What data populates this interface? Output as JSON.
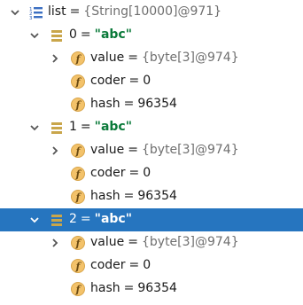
{
  "root": {
    "name": "list",
    "eq": "=",
    "value": "{String[10000]@971}",
    "expanded": true
  },
  "items": [
    {
      "name": "0",
      "eq": "=",
      "value": "\"abc\"",
      "expanded": true,
      "fields": [
        {
          "name": "value",
          "eq": "=",
          "value": "{byte[3]@974}",
          "kind": "ref",
          "expandable": true
        },
        {
          "name": "coder",
          "eq": "=",
          "value": "0",
          "kind": "num",
          "expandable": false
        },
        {
          "name": "hash",
          "eq": "=",
          "value": "96354",
          "kind": "num",
          "expandable": false
        }
      ]
    },
    {
      "name": "1",
      "eq": "=",
      "value": "\"abc\"",
      "expanded": true,
      "fields": [
        {
          "name": "value",
          "eq": "=",
          "value": "{byte[3]@974}",
          "kind": "ref",
          "expandable": true
        },
        {
          "name": "coder",
          "eq": "=",
          "value": "0",
          "kind": "num",
          "expandable": false
        },
        {
          "name": "hash",
          "eq": "=",
          "value": "96354",
          "kind": "num",
          "expandable": false
        }
      ]
    },
    {
      "name": "2",
      "eq": "=",
      "value": "\"abc\"",
      "expanded": true,
      "selected": true,
      "fields": [
        {
          "name": "value",
          "eq": "=",
          "value": "{byte[3]@974}",
          "kind": "ref",
          "expandable": true
        },
        {
          "name": "coder",
          "eq": "=",
          "value": "0",
          "kind": "num",
          "expandable": false
        },
        {
          "name": "hash",
          "eq": "=",
          "value": "96354",
          "kind": "num",
          "expandable": false
        }
      ]
    }
  ],
  "colors": {
    "selection": "#2675bf",
    "string_value": "#0b7a3a",
    "reference_value": "#6f6f6f",
    "field_icon": "#f3c26a",
    "array_icon": "#c9a64b"
  },
  "icons": {
    "root": "list-array-icon",
    "item": "array-element-icon",
    "field": "field-icon",
    "expand": "chevron-down-icon",
    "collapse": "chevron-right-icon"
  }
}
